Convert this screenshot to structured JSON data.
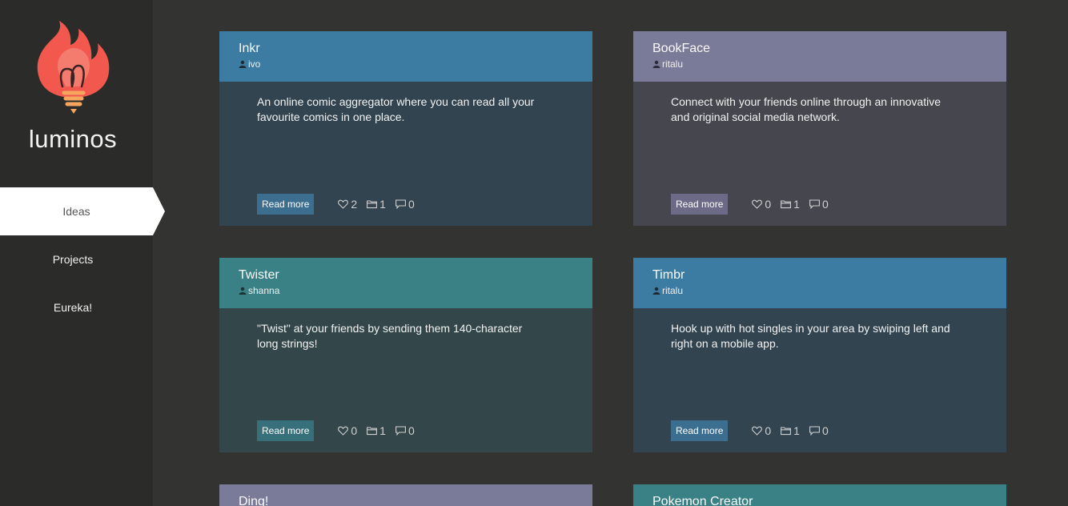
{
  "brand": {
    "name": "luminos",
    "logo_colors": {
      "flame": "#f2584e",
      "bulb": "#f7a65f",
      "line": "#3a2222"
    }
  },
  "nav": {
    "items": [
      {
        "label": "Ideas",
        "active": true
      },
      {
        "label": "Projects",
        "active": false
      },
      {
        "label": "Eureka!",
        "active": false
      }
    ]
  },
  "cards": [
    {
      "title": "Inkr",
      "author": "ivo",
      "color": "blue",
      "description": "An online comic aggregator where you can read all your favourite comics in one place.",
      "read_more": "Read more",
      "likes": "2",
      "folders": "1",
      "comments": "0"
    },
    {
      "title": "BookFace",
      "author": "ritalu",
      "color": "purple",
      "description": "Connect with your friends online through an innovative and original social media network.",
      "read_more": "Read more",
      "likes": "0",
      "folders": "1",
      "comments": "0"
    },
    {
      "title": "Twister",
      "author": "shanna",
      "color": "teal",
      "description": "\"Twist\" at your friends by sending them 140-character long strings!",
      "read_more": "Read more",
      "likes": "0",
      "folders": "1",
      "comments": "0"
    },
    {
      "title": "Timbr",
      "author": "ritalu",
      "color": "blue",
      "description": "Hook up with hot singles in your area by swiping left and right on a mobile app.",
      "read_more": "Read more",
      "likes": "0",
      "folders": "1",
      "comments": "0"
    },
    {
      "title": "Ding!",
      "color": "purple"
    },
    {
      "title": "Pokemon Creator",
      "color": "teal"
    }
  ],
  "icons": {
    "user": "user-icon",
    "like": "heart-icon",
    "folder": "folder-icon",
    "comment": "comment-icon"
  }
}
